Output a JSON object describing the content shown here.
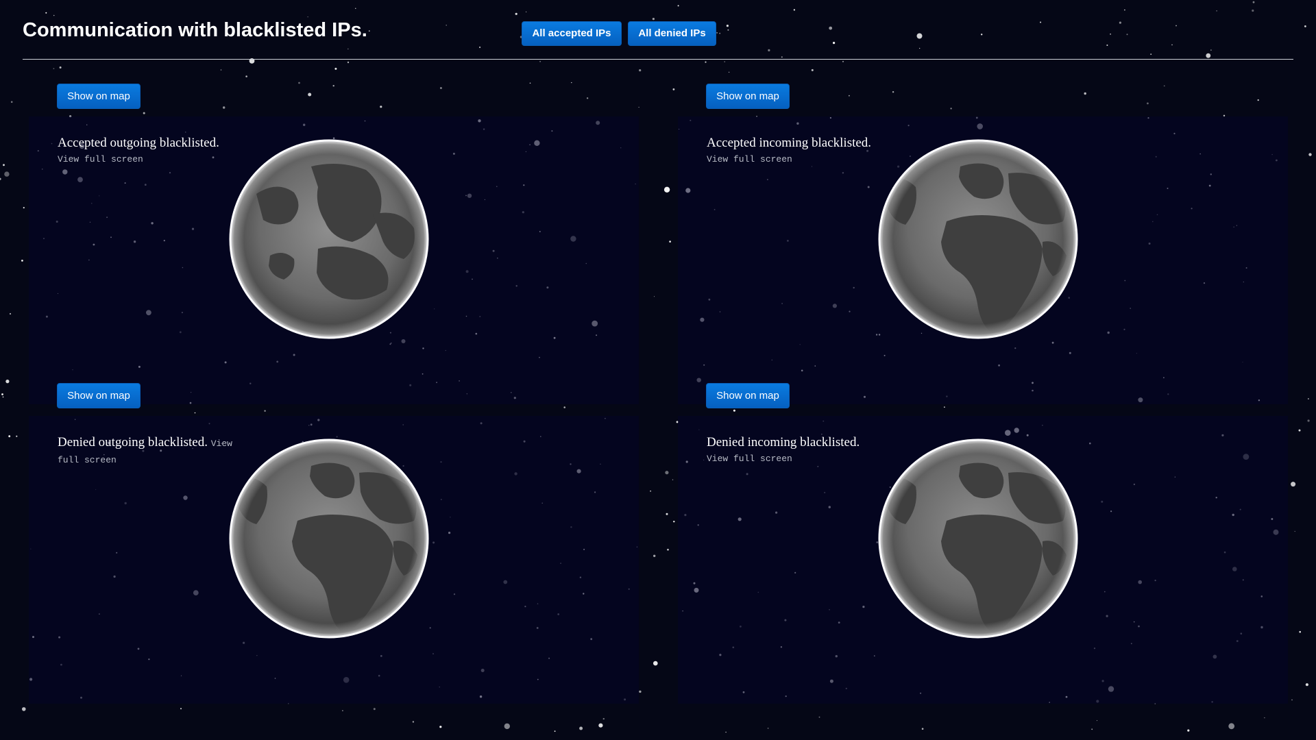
{
  "header": {
    "title": "Communication with blacklisted IPs.",
    "buttons": {
      "all_accepted": "All accepted IPs",
      "all_denied": "All denied IPs"
    }
  },
  "panels": [
    {
      "title": "Accepted outgoing blacklisted.",
      "fullscreen_link": "View full screen",
      "map_button": "Show on map"
    },
    {
      "title": "Accepted incoming blacklisted.",
      "fullscreen_link": "View full screen",
      "map_button": "Show on map"
    },
    {
      "title": "Denied outgoing blacklisted.",
      "fullscreen_link": "View full screen",
      "map_button": "Show on map"
    },
    {
      "title": "Denied incoming blacklisted.",
      "fullscreen_link": "View full screen",
      "map_button": "Show on map"
    }
  ],
  "colors": {
    "background": "#050716",
    "button": "#0a6fd4",
    "globe_rim": "#ffffff",
    "connection_line": "#ffffff"
  }
}
